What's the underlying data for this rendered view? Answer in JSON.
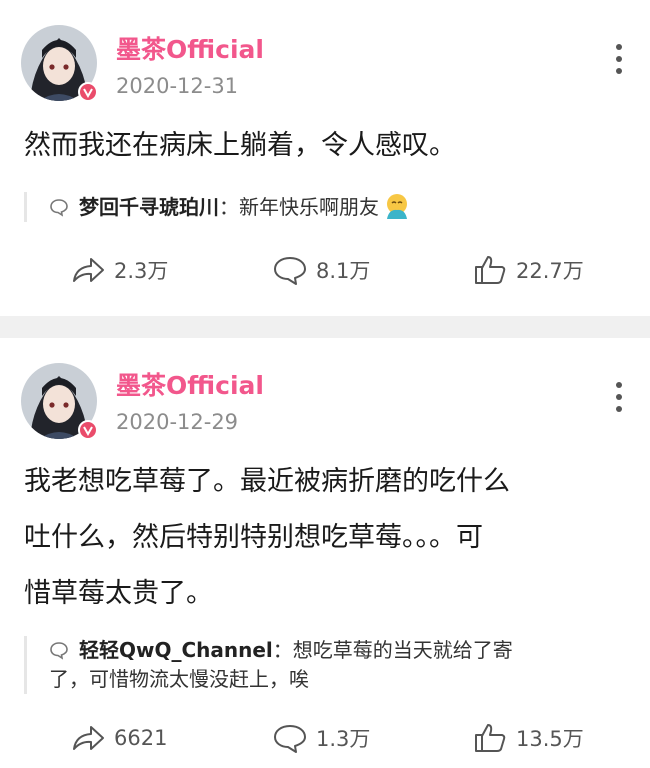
{
  "posts": [
    {
      "username": "墨茶Official",
      "date": "2020-12-31",
      "content": "然而我还在病床上躺着，令人感叹。",
      "comment": {
        "author": "梦回千寻琥珀川",
        "separator": "：",
        "text": "新年快乐啊朋友"
      },
      "stats": {
        "shares": "2.3万",
        "comments": "8.1万",
        "likes": "22.7万"
      }
    },
    {
      "username": "墨茶Official",
      "date": "2020-12-29",
      "content_lines": [
        "我老想吃草莓了。最近被病折磨的吃什么",
        "吐什么，然后特别特别想吃草莓。。。可",
        "惜草莓太贵了。"
      ],
      "comment": {
        "author": "轻轻QwQ_Channel",
        "separator": "：",
        "text_line1": "想吃草莓的当天就给了寄",
        "text_line2": "了，可惜物流太慢没赶上，唉"
      },
      "stats": {
        "shares": "6621",
        "comments": "1.3万",
        "likes": "13.5万"
      }
    }
  ],
  "colors": {
    "username": "#f2578c",
    "date": "#8c8c8c",
    "badge": "#ea4c6b",
    "separator": "#f0f0f0"
  },
  "icons": [
    "avatar",
    "vip-badge-icon",
    "more-icon",
    "comment-bubble-icon",
    "emoji-icon",
    "share-icon",
    "comment-icon",
    "like-icon"
  ]
}
